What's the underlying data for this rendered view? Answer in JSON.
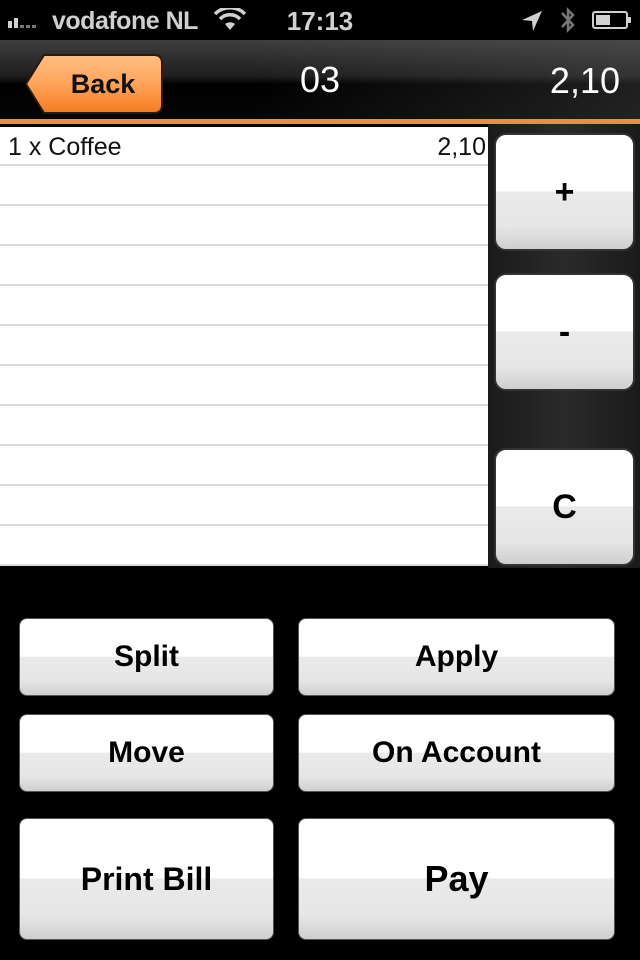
{
  "status_bar": {
    "carrier": "vodafone NL",
    "time": "17:13",
    "signal_bars": 2,
    "signal_bars_max": 5,
    "battery_level": 0.5,
    "icons": [
      "signal-icon",
      "wifi-icon",
      "location-arrow-icon",
      "bluetooth-icon",
      "battery-icon"
    ]
  },
  "nav": {
    "back_label": "Back",
    "title": "03",
    "total": "2,10",
    "accent_color": "#f08a4a"
  },
  "order": {
    "items": [
      {
        "label": "1 x Coffee",
        "price": "2,10"
      },
      {
        "label": "",
        "price": ""
      },
      {
        "label": "",
        "price": ""
      },
      {
        "label": "",
        "price": ""
      },
      {
        "label": "",
        "price": ""
      },
      {
        "label": "",
        "price": ""
      },
      {
        "label": "",
        "price": ""
      },
      {
        "label": "",
        "price": ""
      },
      {
        "label": "",
        "price": ""
      },
      {
        "label": "",
        "price": ""
      },
      {
        "label": "",
        "price": ""
      }
    ]
  },
  "side_buttons": {
    "plus": "+",
    "minus": "-",
    "clear": "C"
  },
  "actions": {
    "split": "Split",
    "apply": "Apply",
    "move": "Move",
    "on_account": "On Account",
    "print_bill": "Print Bill",
    "pay": "Pay"
  }
}
